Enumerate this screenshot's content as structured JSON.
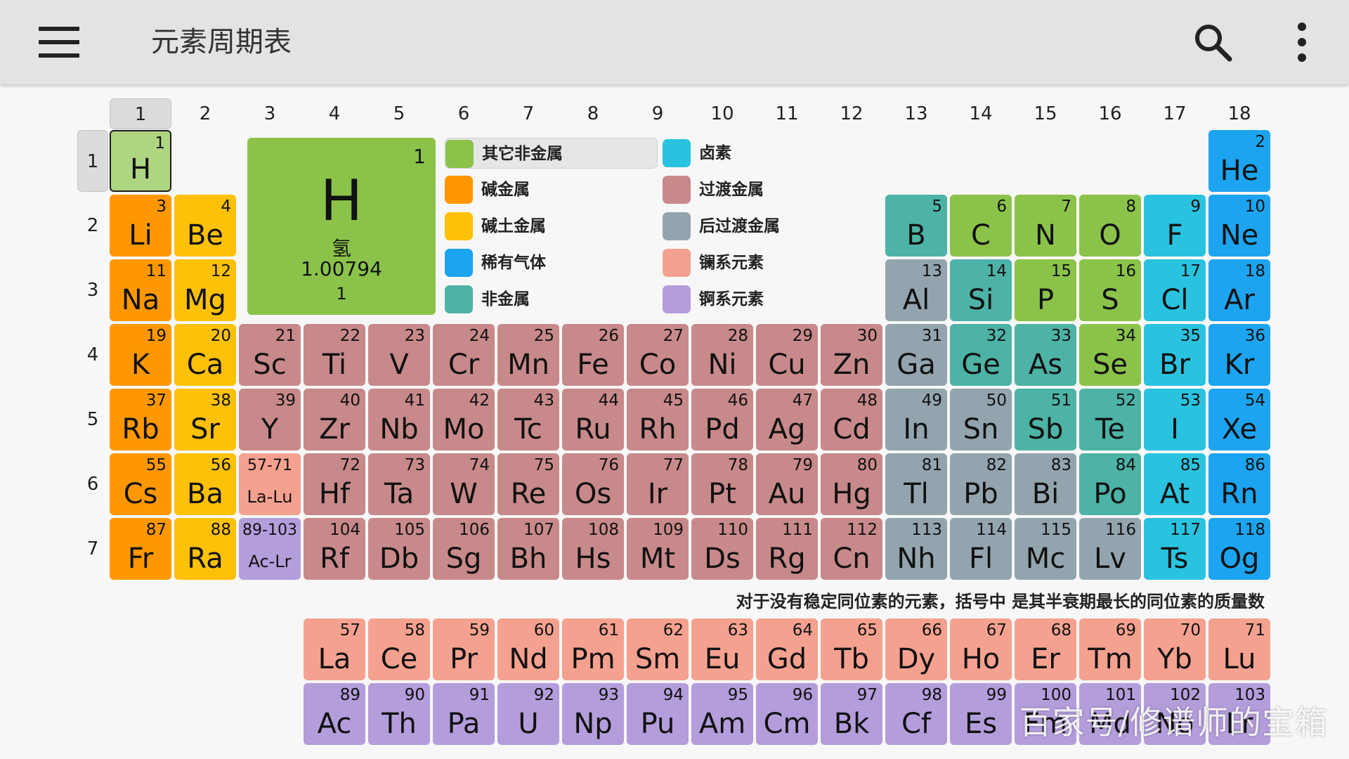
{
  "app": {
    "title": "元素周期表"
  },
  "colors": {
    "other_nonmetal": "#8bc34a",
    "alkali": "#ff9800",
    "alkaline_earth": "#ffc107",
    "noble_gas": "#1ca4f0",
    "metalloid": "#4cb3a6",
    "halogen": "#29c3e0",
    "transition": "#c8898a",
    "post_transition": "#93a4ae",
    "lanthanide": "#f5a190",
    "actinide": "#b39ddb",
    "selected_light": "#aed581"
  },
  "columns": [
    "1",
    "2",
    "3",
    "4",
    "5",
    "6",
    "7",
    "8",
    "9",
    "10",
    "11",
    "12",
    "13",
    "14",
    "15",
    "16",
    "17",
    "18"
  ],
  "rows": [
    "1",
    "2",
    "3",
    "4",
    "5",
    "6",
    "7"
  ],
  "selected_element": {
    "number": "1",
    "symbol": "H",
    "name": "氢",
    "mass": "1.00794",
    "group": "1"
  },
  "legend": [
    {
      "label": "其它非金属",
      "cat": "other_nonmetal"
    },
    {
      "label": "碱金属",
      "cat": "alkali"
    },
    {
      "label": "碱土金属",
      "cat": "alkaline_earth"
    },
    {
      "label": "稀有气体",
      "cat": "noble_gas"
    },
    {
      "label": "非金属",
      "cat": "metalloid"
    },
    {
      "label": "卤素",
      "cat": "halogen"
    },
    {
      "label": "过渡金属",
      "cat": "transition"
    },
    {
      "label": "后过渡金属",
      "cat": "post_transition"
    },
    {
      "label": "镧系元素",
      "cat": "lanthanide"
    },
    {
      "label": "锕系元素",
      "cat": "actinide"
    }
  ],
  "note": "对于没有稳定同位素的元素，括号中 是其半衰期最长的同位素的质量数",
  "watermark": "百家号/修谱师的宝箱",
  "elements": [
    [
      "1",
      "H",
      1,
      1,
      "other_nonmetal"
    ],
    [
      "2",
      "He",
      1,
      18,
      "noble_gas"
    ],
    [
      "3",
      "Li",
      2,
      1,
      "alkali"
    ],
    [
      "4",
      "Be",
      2,
      2,
      "alkaline_earth"
    ],
    [
      "5",
      "B",
      2,
      13,
      "metalloid"
    ],
    [
      "6",
      "C",
      2,
      14,
      "other_nonmetal"
    ],
    [
      "7",
      "N",
      2,
      15,
      "other_nonmetal"
    ],
    [
      "8",
      "O",
      2,
      16,
      "other_nonmetal"
    ],
    [
      "9",
      "F",
      2,
      17,
      "halogen"
    ],
    [
      "10",
      "Ne",
      2,
      18,
      "noble_gas"
    ],
    [
      "11",
      "Na",
      3,
      1,
      "alkali"
    ],
    [
      "12",
      "Mg",
      3,
      2,
      "alkaline_earth"
    ],
    [
      "13",
      "Al",
      3,
      13,
      "post_transition"
    ],
    [
      "14",
      "Si",
      3,
      14,
      "metalloid"
    ],
    [
      "15",
      "P",
      3,
      15,
      "other_nonmetal"
    ],
    [
      "16",
      "S",
      3,
      16,
      "other_nonmetal"
    ],
    [
      "17",
      "Cl",
      3,
      17,
      "halogen"
    ],
    [
      "18",
      "Ar",
      3,
      18,
      "noble_gas"
    ],
    [
      "19",
      "K",
      4,
      1,
      "alkali"
    ],
    [
      "20",
      "Ca",
      4,
      2,
      "alkaline_earth"
    ],
    [
      "21",
      "Sc",
      4,
      3,
      "transition"
    ],
    [
      "22",
      "Ti",
      4,
      4,
      "transition"
    ],
    [
      "23",
      "V",
      4,
      5,
      "transition"
    ],
    [
      "24",
      "Cr",
      4,
      6,
      "transition"
    ],
    [
      "25",
      "Mn",
      4,
      7,
      "transition"
    ],
    [
      "26",
      "Fe",
      4,
      8,
      "transition"
    ],
    [
      "27",
      "Co",
      4,
      9,
      "transition"
    ],
    [
      "28",
      "Ni",
      4,
      10,
      "transition"
    ],
    [
      "29",
      "Cu",
      4,
      11,
      "transition"
    ],
    [
      "30",
      "Zn",
      4,
      12,
      "transition"
    ],
    [
      "31",
      "Ga",
      4,
      13,
      "post_transition"
    ],
    [
      "32",
      "Ge",
      4,
      14,
      "metalloid"
    ],
    [
      "33",
      "As",
      4,
      15,
      "metalloid"
    ],
    [
      "34",
      "Se",
      4,
      16,
      "other_nonmetal"
    ],
    [
      "35",
      "Br",
      4,
      17,
      "halogen"
    ],
    [
      "36",
      "Kr",
      4,
      18,
      "noble_gas"
    ],
    [
      "37",
      "Rb",
      5,
      1,
      "alkali"
    ],
    [
      "38",
      "Sr",
      5,
      2,
      "alkaline_earth"
    ],
    [
      "39",
      "Y",
      5,
      3,
      "transition"
    ],
    [
      "40",
      "Zr",
      5,
      4,
      "transition"
    ],
    [
      "41",
      "Nb",
      5,
      5,
      "transition"
    ],
    [
      "42",
      "Mo",
      5,
      6,
      "transition"
    ],
    [
      "43",
      "Tc",
      5,
      7,
      "transition"
    ],
    [
      "44",
      "Ru",
      5,
      8,
      "transition"
    ],
    [
      "45",
      "Rh",
      5,
      9,
      "transition"
    ],
    [
      "46",
      "Pd",
      5,
      10,
      "transition"
    ],
    [
      "47",
      "Ag",
      5,
      11,
      "transition"
    ],
    [
      "48",
      "Cd",
      5,
      12,
      "transition"
    ],
    [
      "49",
      "In",
      5,
      13,
      "post_transition"
    ],
    [
      "50",
      "Sn",
      5,
      14,
      "post_transition"
    ],
    [
      "51",
      "Sb",
      5,
      15,
      "metalloid"
    ],
    [
      "52",
      "Te",
      5,
      16,
      "metalloid"
    ],
    [
      "53",
      "I",
      5,
      17,
      "halogen"
    ],
    [
      "54",
      "Xe",
      5,
      18,
      "noble_gas"
    ],
    [
      "55",
      "Cs",
      6,
      1,
      "alkali"
    ],
    [
      "56",
      "Ba",
      6,
      2,
      "alkaline_earth"
    ],
    [
      "72",
      "Hf",
      6,
      4,
      "transition"
    ],
    [
      "73",
      "Ta",
      6,
      5,
      "transition"
    ],
    [
      "74",
      "W",
      6,
      6,
      "transition"
    ],
    [
      "75",
      "Re",
      6,
      7,
      "transition"
    ],
    [
      "76",
      "Os",
      6,
      8,
      "transition"
    ],
    [
      "77",
      "Ir",
      6,
      9,
      "transition"
    ],
    [
      "78",
      "Pt",
      6,
      10,
      "transition"
    ],
    [
      "79",
      "Au",
      6,
      11,
      "transition"
    ],
    [
      "80",
      "Hg",
      6,
      12,
      "transition"
    ],
    [
      "81",
      "Tl",
      6,
      13,
      "post_transition"
    ],
    [
      "82",
      "Pb",
      6,
      14,
      "post_transition"
    ],
    [
      "83",
      "Bi",
      6,
      15,
      "post_transition"
    ],
    [
      "84",
      "Po",
      6,
      16,
      "metalloid"
    ],
    [
      "85",
      "At",
      6,
      17,
      "halogen"
    ],
    [
      "86",
      "Rn",
      6,
      18,
      "noble_gas"
    ],
    [
      "87",
      "Fr",
      7,
      1,
      "alkali"
    ],
    [
      "88",
      "Ra",
      7,
      2,
      "alkaline_earth"
    ],
    [
      "104",
      "Rf",
      7,
      4,
      "transition"
    ],
    [
      "105",
      "Db",
      7,
      5,
      "transition"
    ],
    [
      "106",
      "Sg",
      7,
      6,
      "transition"
    ],
    [
      "107",
      "Bh",
      7,
      7,
      "transition"
    ],
    [
      "108",
      "Hs",
      7,
      8,
      "transition"
    ],
    [
      "109",
      "Mt",
      7,
      9,
      "transition"
    ],
    [
      "110",
      "Ds",
      7,
      10,
      "transition"
    ],
    [
      "111",
      "Rg",
      7,
      11,
      "transition"
    ],
    [
      "112",
      "Cn",
      7,
      12,
      "transition"
    ],
    [
      "113",
      "Nh",
      7,
      13,
      "post_transition"
    ],
    [
      "114",
      "Fl",
      7,
      14,
      "post_transition"
    ],
    [
      "115",
      "Mc",
      7,
      15,
      "post_transition"
    ],
    [
      "116",
      "Lv",
      7,
      16,
      "post_transition"
    ],
    [
      "117",
      "Ts",
      7,
      17,
      "halogen"
    ],
    [
      "118",
      "Og",
      7,
      18,
      "noble_gas"
    ],
    [
      "57",
      "La",
      9,
      4,
      "lanthanide"
    ],
    [
      "58",
      "Ce",
      9,
      5,
      "lanthanide"
    ],
    [
      "59",
      "Pr",
      9,
      6,
      "lanthanide"
    ],
    [
      "60",
      "Nd",
      9,
      7,
      "lanthanide"
    ],
    [
      "61",
      "Pm",
      9,
      8,
      "lanthanide"
    ],
    [
      "62",
      "Sm",
      9,
      9,
      "lanthanide"
    ],
    [
      "63",
      "Eu",
      9,
      10,
      "lanthanide"
    ],
    [
      "64",
      "Gd",
      9,
      11,
      "lanthanide"
    ],
    [
      "65",
      "Tb",
      9,
      12,
      "lanthanide"
    ],
    [
      "66",
      "Dy",
      9,
      13,
      "lanthanide"
    ],
    [
      "67",
      "Ho",
      9,
      14,
      "lanthanide"
    ],
    [
      "68",
      "Er",
      9,
      15,
      "lanthanide"
    ],
    [
      "69",
      "Tm",
      9,
      16,
      "lanthanide"
    ],
    [
      "70",
      "Yb",
      9,
      17,
      "lanthanide"
    ],
    [
      "71",
      "Lu",
      9,
      18,
      "lanthanide"
    ],
    [
      "89",
      "Ac",
      10,
      4,
      "actinide"
    ],
    [
      "90",
      "Th",
      10,
      5,
      "actinide"
    ],
    [
      "91",
      "Pa",
      10,
      6,
      "actinide"
    ],
    [
      "92",
      "U",
      10,
      7,
      "actinide"
    ],
    [
      "93",
      "Np",
      10,
      8,
      "actinide"
    ],
    [
      "94",
      "Pu",
      10,
      9,
      "actinide"
    ],
    [
      "95",
      "Am",
      10,
      10,
      "actinide"
    ],
    [
      "96",
      "Cm",
      10,
      11,
      "actinide"
    ],
    [
      "97",
      "Bk",
      10,
      12,
      "actinide"
    ],
    [
      "98",
      "Cf",
      10,
      13,
      "actinide"
    ],
    [
      "99",
      "Es",
      10,
      14,
      "actinide"
    ],
    [
      "100",
      "Fm",
      10,
      15,
      "actinide"
    ],
    [
      "101",
      "Md",
      10,
      16,
      "actinide"
    ],
    [
      "102",
      "No",
      10,
      17,
      "actinide"
    ],
    [
      "103",
      "Lr",
      10,
      18,
      "actinide"
    ]
  ],
  "ranges": [
    {
      "range": "57-71",
      "symbol": "La-Lu",
      "row": 6,
      "col": 3,
      "cat": "lanthanide"
    },
    {
      "range": "89-103",
      "symbol": "Ac-Lr",
      "row": 7,
      "col": 3,
      "cat": "actinide"
    }
  ]
}
